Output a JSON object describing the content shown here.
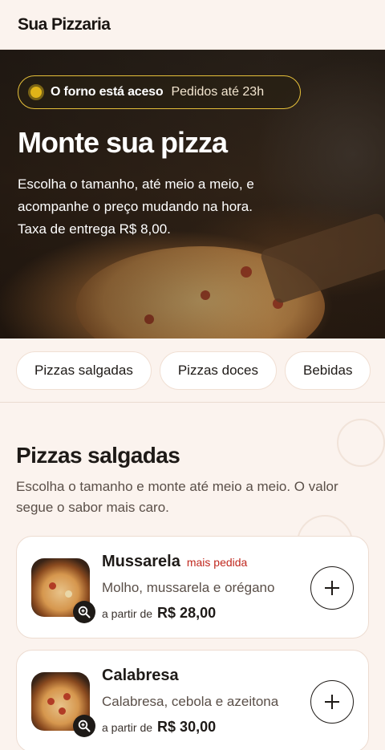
{
  "header": {
    "brand": "Sua Pizzaria"
  },
  "hero": {
    "status_main": "O forno está aceso",
    "status_sub": "Pedidos até 23h",
    "title": "Monte sua pizza",
    "description": "Escolha o tamanho, até meio a meio, e acompanhe o preço mudando na hora. Taxa de entrega R$ 8,00."
  },
  "tabs": [
    "Pizzas salgadas",
    "Pizzas doces",
    "Bebidas"
  ],
  "section": {
    "title": "Pizzas salgadas",
    "description": "Escolha o tamanho e monte até meio a meio. O valor segue o sabor mais caro."
  },
  "products": [
    {
      "name": "Mussarela",
      "badge": "mais pedida",
      "ingredients": "Molho, mussarela e orégano",
      "from_label": "a partir de",
      "price": "R$ 28,00"
    },
    {
      "name": "Calabresa",
      "badge": "",
      "ingredients": "Calabresa, cebola e azeitona",
      "from_label": "a partir de",
      "price": "R$ 30,00"
    }
  ],
  "icons": {
    "zoom": "zoom-in-icon",
    "add": "plus-icon",
    "status": "status-dot-icon"
  },
  "colors": {
    "accent_yellow": "#e0b418",
    "badge_red": "#c0281e",
    "background": "#fbf3ee"
  }
}
